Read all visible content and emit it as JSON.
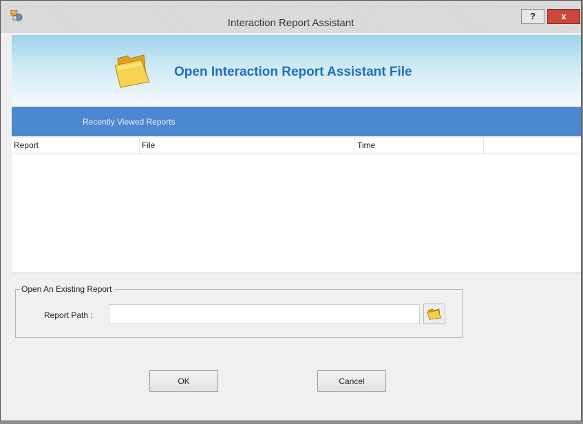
{
  "window": {
    "title": "Interaction Report Assistant",
    "help_label": "?",
    "close_label": "x"
  },
  "banner": {
    "title": "Open Interaction Report Assistant File",
    "icon": "folder-icon"
  },
  "recent": {
    "label": "Recently Viewed Reports",
    "columns": [
      "Report",
      "File",
      "Time",
      ""
    ],
    "rows": []
  },
  "open_existing": {
    "legend": "Open An Existing Report",
    "report_path_label": "Report Path :",
    "report_path_value": "",
    "browse_icon": "folder-icon"
  },
  "buttons": {
    "ok": "OK",
    "cancel": "Cancel"
  },
  "colors": {
    "accent": "#4d87d0",
    "banner_title": "#1f6dc0",
    "close": "#c9483b"
  }
}
